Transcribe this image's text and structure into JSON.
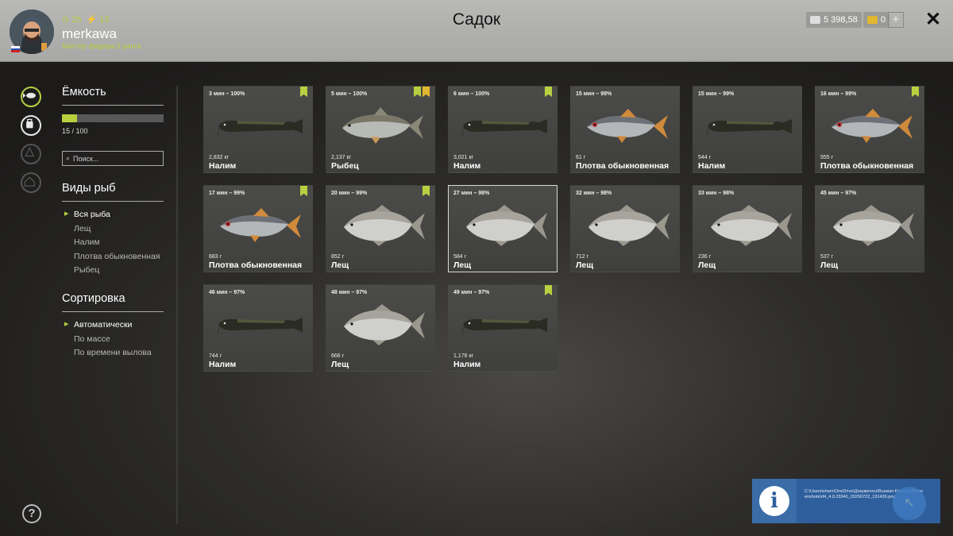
{
  "header": {
    "title": "Садок",
    "stat_level": "25",
    "stat_energy": "13",
    "username": "merkawa",
    "rank": "Мастер фидера 2 ранга",
    "silver": "5 398,58",
    "gold": "0",
    "plus_label": "+",
    "close_label": "✕"
  },
  "colors": {
    "accent": "#b8d040",
    "gold": "#e0b830",
    "notify": "#2e5f9c"
  },
  "panel": {
    "capacity_title": "Ёмкость",
    "capacity_used": 15,
    "capacity_max": 100,
    "capacity_text": "15 / 100",
    "search_placeholder": "Поиск...",
    "species_title": "Виды рыб",
    "species": [
      "Вся рыба",
      "Лещ",
      "Налим",
      "Плотва обыкновенная",
      "Рыбец"
    ],
    "sort_title": "Сортировка",
    "sort_options": [
      "Автоматически",
      "По массе",
      "По времени вылова"
    ]
  },
  "fish": [
    {
      "time": "3 мин – 100%",
      "weight": "2,832 кг",
      "name": "Налим",
      "kind": "burbot",
      "badges": [
        "green"
      ]
    },
    {
      "time": "5 мин – 100%",
      "weight": "2,137 кг",
      "name": "Рыбец",
      "kind": "vimba",
      "badges": [
        "green",
        "gold"
      ]
    },
    {
      "time": "6 мин – 100%",
      "weight": "3,021 кг",
      "name": "Налим",
      "kind": "burbot",
      "badges": [
        "green"
      ]
    },
    {
      "time": "15 мин – 99%",
      "weight": "61 г",
      "name": "Плотва обыкновенная",
      "kind": "roach",
      "badges": []
    },
    {
      "time": "15 мин – 99%",
      "weight": "544 г",
      "name": "Налим",
      "kind": "burbot",
      "badges": []
    },
    {
      "time": "16 мин – 99%",
      "weight": "555 г",
      "name": "Плотва обыкновенная",
      "kind": "roach",
      "badges": [
        "green"
      ]
    },
    {
      "time": "17 мин – 99%",
      "weight": "683 г",
      "name": "Плотва обыкновенная",
      "kind": "roach",
      "badges": [
        "green"
      ]
    },
    {
      "time": "20 мин – 99%",
      "weight": "852 г",
      "name": "Лещ",
      "kind": "bream",
      "badges": [
        "green"
      ]
    },
    {
      "time": "27 мин – 98%",
      "weight": "584 г",
      "name": "Лещ",
      "kind": "bream",
      "badges": []
    },
    {
      "time": "32 мин – 98%",
      "weight": "712 г",
      "name": "Лещ",
      "kind": "bream",
      "badges": []
    },
    {
      "time": "33 мин – 98%",
      "weight": "236 г",
      "name": "Лещ",
      "kind": "bream",
      "badges": []
    },
    {
      "time": "45 мин – 97%",
      "weight": "537 г",
      "name": "Лещ",
      "kind": "bream",
      "badges": []
    },
    {
      "time": "46 мин – 97%",
      "weight": "744 г",
      "name": "Налим",
      "kind": "burbot",
      "badges": []
    },
    {
      "time": "48 мин – 97%",
      "weight": "666 г",
      "name": "Лещ",
      "kind": "bream",
      "badges": []
    },
    {
      "time": "49 мин – 97%",
      "weight": "1,176 кг",
      "name": "Налим",
      "kind": "burbot",
      "badges": [
        "green"
      ]
    }
  ],
  "notification": {
    "text": "C:\\Users\\sharv\\OneDrive\\Документы\\Russian Fishing 4\\Screenshots\\rf4_4.0.23340_20250722_131439.png",
    "icon_label": "i"
  }
}
